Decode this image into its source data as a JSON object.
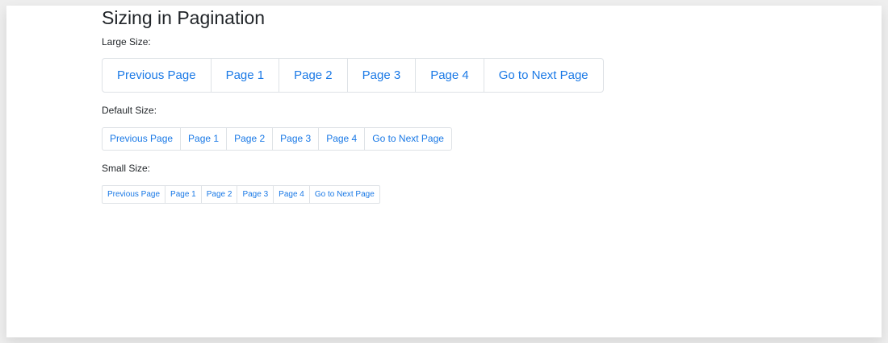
{
  "title": "Sizing in Pagination",
  "sections": [
    {
      "label": "Large Size:",
      "items": [
        "Previous Page",
        "Page 1",
        "Page 2",
        "Page 3",
        "Page 4",
        "Go to Next Page"
      ]
    },
    {
      "label": "Default Size:",
      "items": [
        "Previous Page",
        "Page 1",
        "Page 2",
        "Page 3",
        "Page 4",
        "Go to Next Page"
      ]
    },
    {
      "label": "Small Size:",
      "items": [
        "Previous Page",
        "Page 1",
        "Page 2",
        "Page 3",
        "Page 4",
        "Go to Next Page"
      ]
    }
  ],
  "colors": {
    "link": "#1a79e6",
    "border": "#dee2e6",
    "text": "#212529",
    "background": "#ffffff"
  }
}
